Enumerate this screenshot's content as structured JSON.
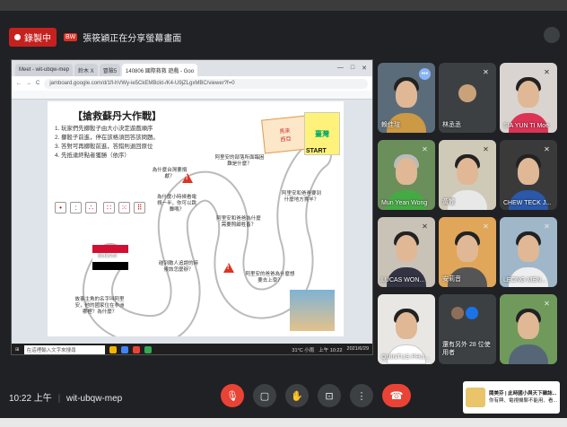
{
  "meeting": {
    "recording_label": "錄製中",
    "presenter_tag": "BW",
    "presenter_text": "張筱穎正在分享螢幕畫面",
    "time": "10:22 上午",
    "code": "wit-ubqw-mep"
  },
  "browser": {
    "tabs": [
      "Meet - wit-ubqw-mep",
      "鈴木 X",
      "冒險5",
      "140806 國際救救 遊戲 - Goo"
    ],
    "url": "jamboard.google.com/d/1fl-hVWy-ie5CkEMBckt-/K4-U9jZLgxMBC/viewer?f=0"
  },
  "board": {
    "title": "【搶救蘇丹大作戰】",
    "rules": [
      "1. 玩家們先擲骰子由大小決定遊戲順序",
      "2. 擲骰子前進，停在該格須回答該問題。",
      "3. 答對可再擲骰前進，答錯則退回原位",
      "4. 先抵達終點者獲勝（依序）"
    ],
    "start_card": [
      "馬來",
      "西亞"
    ],
    "taiwan": "臺灣",
    "start": "START",
    "sudan": "SUDAN",
    "questions": [
      "阿里安的部落所面臨困難是什麼？",
      "為什麼台灣要捐獻？",
      "為什麼小時候看電視一半，你可以跳舞嗎？",
      "阿里安和爸爸為什麼需要照顧牲畜？",
      "碰到敵人追趕的時候該怎麼辦？",
      "阿里安和爸爸要到什麼地方賣羊？",
      "故事主角的名字叫阿里安，他的國家位在非洲哪裡？為什麼？",
      "阿里安的爸爸為什麼想要去上學？"
    ]
  },
  "taskbar": {
    "search": "在這裡輸入文字來搜尋",
    "weather": "31°C 小雨",
    "clock_small": "上午 10:22",
    "date_small": "2021/6/29"
  },
  "participants": [
    {
      "name": "賴佳瑄",
      "speaking": true
    },
    {
      "name": "林丞丞",
      "speaking": false
    },
    {
      "name": "SIA YUN TI Moe",
      "speaking": false
    },
    {
      "name": "Mun Yean Wong",
      "speaking": false
    },
    {
      "name": "黃麗",
      "speaking": false
    },
    {
      "name": "CHEW TECK J...",
      "speaking": false
    },
    {
      "name": "LUCAS WON...",
      "speaking": false
    },
    {
      "name": "安莉音",
      "speaking": false
    },
    {
      "name": "LEONG MEN...",
      "speaking": false
    },
    {
      "name": "QUINTUS PHU...",
      "speaking": false
    },
    {
      "name": "還有另外 28 位使用者",
      "speaking": false
    },
    {
      "name": "",
      "speaking": false
    }
  ],
  "notification": {
    "title": "閱美芬 | 此時國小與天下雜誌...",
    "body": "你有興、電視機聊不能用、看..."
  },
  "colors": {
    "meet_bg": "#202124",
    "tile_bg": "#3c4043",
    "hangup_red": "#ea4335",
    "accent_blue": "#8ab4f8"
  }
}
